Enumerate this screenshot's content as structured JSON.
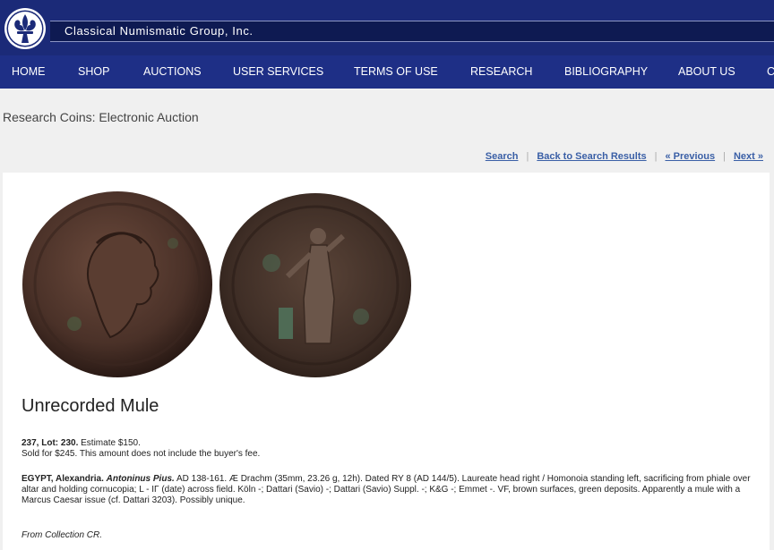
{
  "header": {
    "site_title": "Classical Numismatic Group, Inc."
  },
  "nav": {
    "items": [
      "HOME",
      "SHOP",
      "AUCTIONS",
      "USER SERVICES",
      "TERMS OF USE",
      "RESEARCH",
      "BIBLIOGRAPHY",
      "ABOUT US",
      "C"
    ]
  },
  "page": {
    "heading": "Research Coins: Electronic Auction"
  },
  "result_nav": {
    "search": "Search",
    "back": "Back to Search Results",
    "previous": "« Previous",
    "next": "Next »",
    "separator": "|"
  },
  "lot": {
    "title": "Unrecorded Mule",
    "lot_bold": "237, Lot: 230.",
    "estimate": " Estimate $150.",
    "sold": "Sold for $245. This amount does not include the buyer's fee.",
    "desc_region": "EGYPT, Alexandria.",
    "desc_ruler": "Antoninus Pius.",
    "desc_text": " AD 138-161. Æ Drachm (35mm, 23.26 g, 12h). Dated RY 8 (AD 144/5). Laureate head right / Homonoia standing left, sacrificing from phiale over altar and holding cornucopia; L - IΓ (date) across field. Köln -; Dattari (Savio) -; Dattari (Savio) Suppl. -; K&G -; Emmet -. VF, brown surfaces, green deposits. Apparently a mule with a Marcus Caesar issue (cf. Dattari 3203). Possibly unique.",
    "provenance": "From Collection CR."
  },
  "colors": {
    "header_bg": "#1b2a78",
    "nav_bg": "#1e2f86",
    "link": "#3a5fa6",
    "page_bg": "#f0f0f0"
  },
  "icons": {
    "logo": "fleur-de-lis-logo"
  }
}
